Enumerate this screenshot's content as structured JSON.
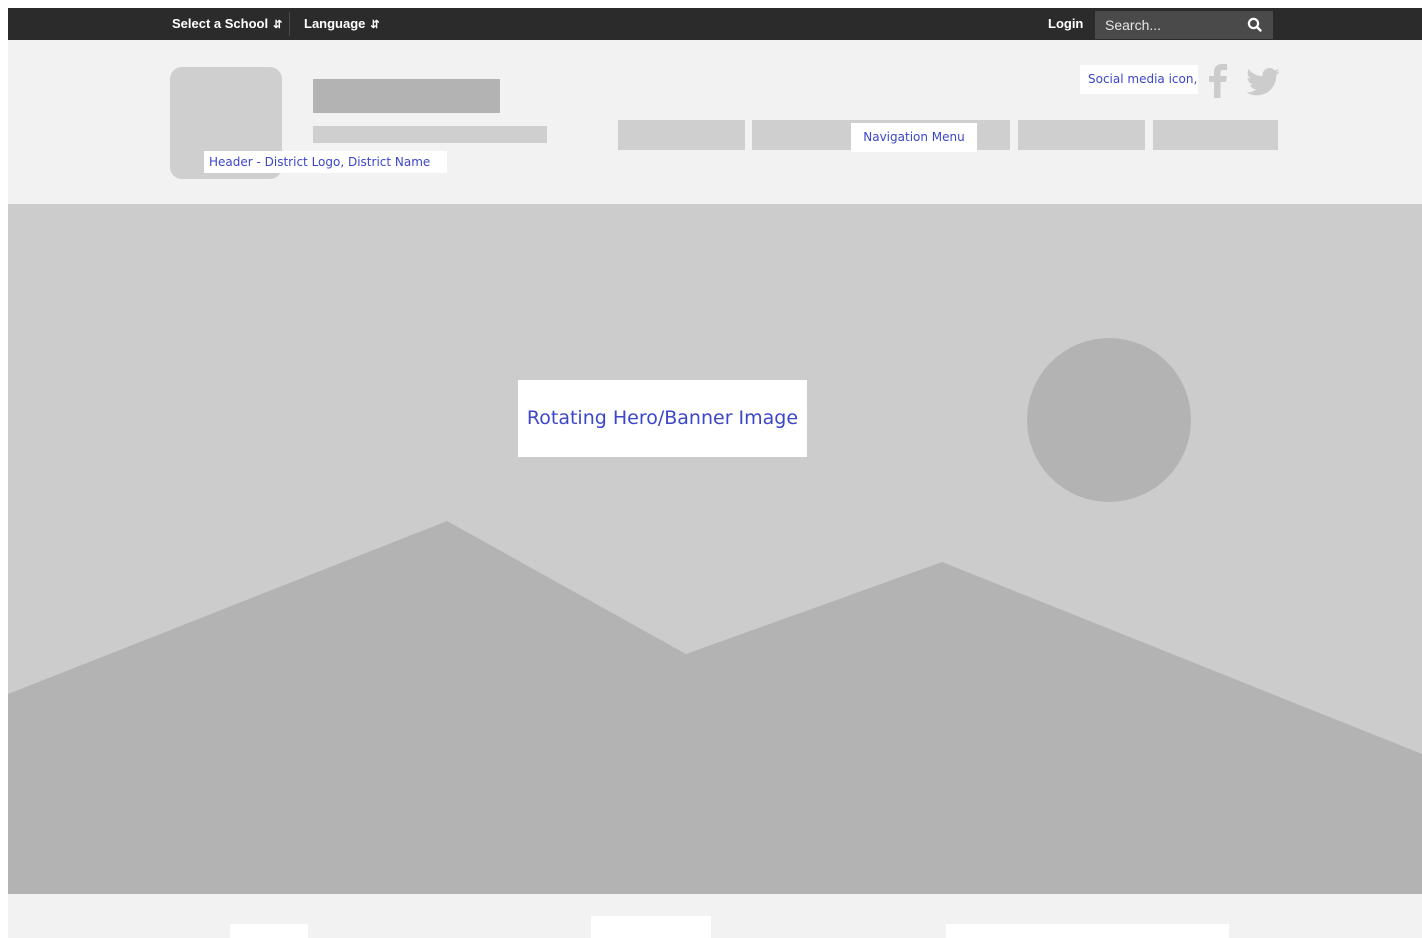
{
  "topbar": {
    "select_school": "Select a School",
    "language": "Language",
    "caret": "▴▾",
    "login": "Login",
    "search_placeholder": "Search..."
  },
  "header": {
    "logo_annotation": "Header - District Logo, District Name",
    "nav_annotation": "Navigation Menu",
    "social_annotation": "Social media icon,",
    "social_icons": [
      "facebook-icon",
      "twitter-icon"
    ]
  },
  "hero": {
    "annotation": "Rotating Hero/Banner Image"
  },
  "colors": {
    "topbar_bg": "#2b2b2b",
    "page_bg": "#f2f2f2",
    "placeholder_light": "#cccccc",
    "placeholder_dark": "#b3b3b3",
    "annotation_text": "#3c46c8"
  }
}
